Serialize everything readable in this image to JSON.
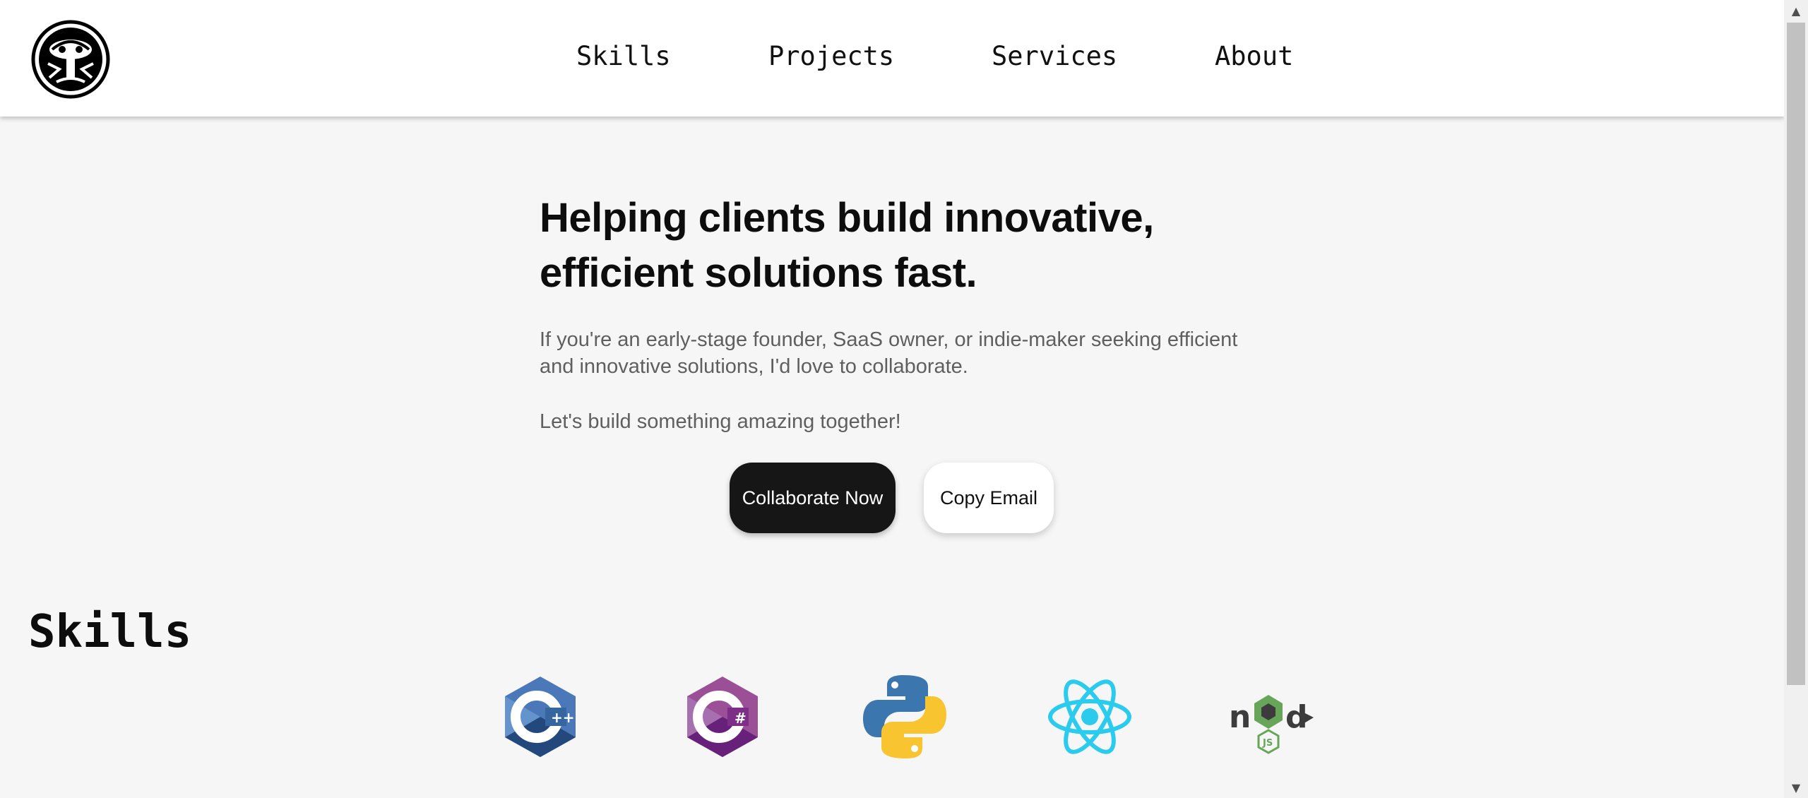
{
  "nav": {
    "items": [
      {
        "label": "Skills"
      },
      {
        "label": "Projects"
      },
      {
        "label": "Services"
      },
      {
        "label": "About"
      }
    ]
  },
  "hero": {
    "title": "Helping clients build innovative, efficient solutions fast.",
    "paragraph_1": "If you're an early-stage founder, SaaS owner, or indie-maker seeking efficient and innovative solutions, I'd love to collaborate.",
    "paragraph_2": "Let's build something amazing together!",
    "primary_button": "Collaborate Now",
    "secondary_button": "Copy Email"
  },
  "skills": {
    "heading": "Skills",
    "icons": [
      "cplusplus-icon",
      "csharp-icon",
      "python-icon",
      "react-icon",
      "nodejs-icon"
    ]
  },
  "colors": {
    "background": "#f6f6f6",
    "header": "#ffffff",
    "primary_button": "#161616",
    "cpp": "#4a78b8",
    "csharp": "#8e3c96",
    "python_blue": "#3b76ae",
    "python_yellow": "#f8c430",
    "react": "#2bcbee",
    "node_green": "#67a659"
  }
}
